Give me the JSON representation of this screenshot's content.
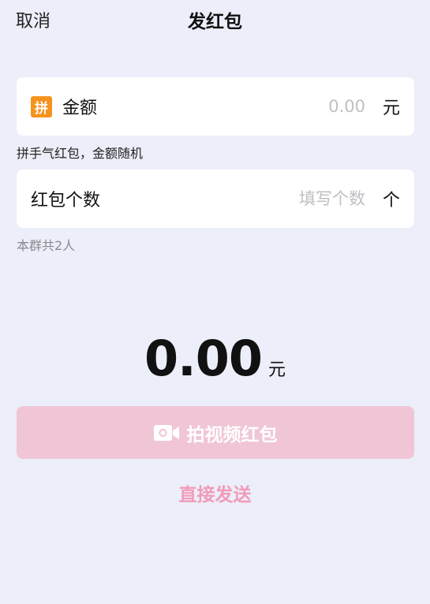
{
  "header": {
    "cancel_label": "取消",
    "title": "发红包"
  },
  "amount_card": {
    "badge": "拼",
    "label": "金额",
    "placeholder": "0.00",
    "unit": "元",
    "hint": "拼手气红包，金额随机"
  },
  "count_card": {
    "label": "红包个数",
    "placeholder": "填写个数",
    "unit": "个",
    "hint": "本群共2人"
  },
  "total": {
    "value": "0.00",
    "unit": "元"
  },
  "video_button": {
    "icon": "camera-icon",
    "label": "拍视频红包"
  },
  "send_link": {
    "label": "直接发送"
  },
  "colors": {
    "background": "#ECEEF9",
    "badge": "#F5931E",
    "button_disabled": "#F0C6D7",
    "link": "#F19BB8"
  }
}
